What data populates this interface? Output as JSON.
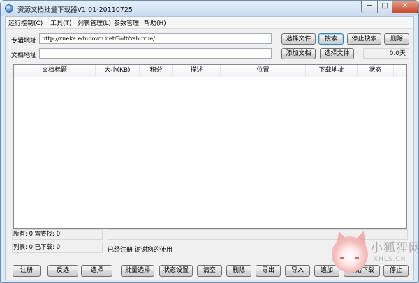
{
  "window": {
    "title": "资源文档批量下载器V1.01-20110725",
    "controls": {
      "minimize": "─",
      "maximize": "□",
      "close": "✕"
    }
  },
  "menu": [
    "运行控制(C)",
    "工具(T)",
    "列表管理(L)",
    "参数管理",
    "帮助(H)"
  ],
  "form": {
    "album_label": "专辑地址",
    "album_value": "http://xueke.edudown.net/Soft/xshuxue/",
    "doc_label": "文档地址",
    "doc_value": "",
    "select_file_1": "选择文件",
    "search": "搜索",
    "stop_search": "停止搜索",
    "delete": "删除",
    "add_doc": "添加文档",
    "select_file_2": "选择文件",
    "days": "0.0天"
  },
  "list": {
    "columns": [
      "文档标题",
      "大小(KB)",
      "积分",
      "描述",
      "位置",
      "下载地址",
      "状态"
    ],
    "rows": []
  },
  "status": {
    "total_pending": "所有: 0 需查找: 0",
    "list_downloaded": "列表: 0 已下载: 0",
    "message": "已经注册 谢谢您的使用"
  },
  "toolbar": [
    "注册",
    "反选",
    "选择",
    "批量选择",
    "状态设置",
    "清空",
    "删除",
    "导出",
    "导入",
    "追加",
    "开始下载",
    "停止"
  ],
  "watermark": {
    "main": "小狐狸网",
    "sub": "XHLS.CN"
  }
}
